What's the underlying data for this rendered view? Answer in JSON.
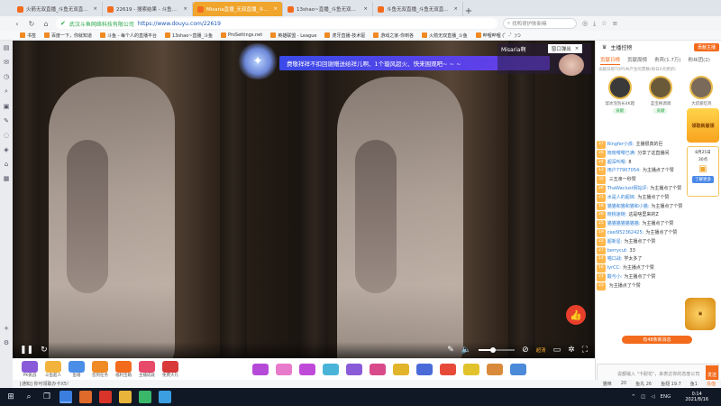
{
  "tabs": [
    {
      "title": "火箭无双直播_斗鱼无双直播视频"
    },
    {
      "title": "22619 - 搜索结果 - 斗鱼直播"
    },
    {
      "title": "Misaria直播_无双直播_斗鱼直播",
      "active": true
    },
    {
      "title": "13shao~直播_斗鱼无双直播视频"
    },
    {
      "title": "斗鱼无双直播_斗鱼无双直播视频"
    }
  ],
  "address": {
    "site_name": "武汉斗鱼网络科技有限公司",
    "url": "https://www.douyu.com/22619",
    "search_placeholder": "找鸭哥护肤新嘛"
  },
  "bookmarks": [
    "书签",
    "百度一下，你就知道",
    "斗鱼 - 每个人的直播平台",
    "13shao~直播_斗鱼",
    "ProSettings.net",
    "英雄联盟 - League",
    "虎牙直播-技术驱",
    "游戏之家-你到各",
    "火箭无双直播_斗鱼",
    "哔哩哔哩 (゜-゜)つ"
  ],
  "video": {
    "streamer_name": "Misaria啊",
    "popout_label": "窗口弹出",
    "banner_text": "费敬祥祥不扣回谢赠送给祥儿啊、1个璇风超火、快来围观吧~ ~ ~",
    "quality_label": "超清",
    "volume": 0.4
  },
  "gifts": [
    {
      "label": "PK挑战",
      "color": "#8a5bd8"
    },
    {
      "label": "斗鱼超人",
      "color": "#f2b33d"
    },
    {
      "label": "鱼塘",
      "color": "#4b8ee8"
    },
    {
      "label": "签到任务",
      "color": "#f08a24"
    },
    {
      "label": "福利宝箱",
      "color": "#f36b1c"
    },
    {
      "label": "主播成就",
      "color": "#e84a6a"
    },
    {
      "label": "免费大礼",
      "color": "#d83a3a"
    },
    {
      "label": "",
      "color": "#b54ad8"
    },
    {
      "label": "",
      "color": "#e87acb"
    },
    {
      "label": "",
      "color": "#c04ad8"
    },
    {
      "label": "",
      "color": "#4ab4d8"
    },
    {
      "label": "",
      "color": "#8a5bd8"
    },
    {
      "label": "",
      "color": "#d84a8a"
    },
    {
      "label": "",
      "color": "#e2b42a"
    },
    {
      "label": "",
      "color": "#4a6ad8"
    },
    {
      "label": "",
      "color": "#e84a3a"
    },
    {
      "label": "",
      "color": "#e2c22a"
    },
    {
      "label": "",
      "color": "#d88a3a"
    },
    {
      "label": "",
      "color": "#4a8ad8"
    }
  ],
  "chat_panel": {
    "title": "主播控榜",
    "add_label": "贡献主播",
    "rank_tabs": [
      "贡献日榜",
      "贡献周榜",
      "贵宾(1.7万)",
      "粉丝团(2)"
    ],
    "rank_desc": "贡献日榜TOP5共产生的票数(每日0点更新)",
    "podium": [
      {
        "name": "溜冰泡泡长4K蹬",
        "tag": "贡献"
      },
      {
        "name": "蓝宝格调调",
        "tag": "贡献"
      },
      {
        "name": "大叔爱吃鸡",
        "tag": "贡献"
      }
    ],
    "messages": [
      {
        "lv": "27",
        "user": "Ringfer小孩:",
        "text": "主播很真的巨"
      },
      {
        "lv": "26",
        "user": "晓晓嘤嘤已满:",
        "text": "分享了这直播间"
      },
      {
        "lv": "24",
        "user": "超深叫嗯:",
        "text": "8"
      },
      {
        "lv": "12",
        "user": "用户77907054:",
        "text": "为主播点了个赞"
      },
      {
        "lv": "32",
        "user": "",
        "text": "三五亲一秒赞"
      },
      {
        "lv": "26",
        "user": "ThaWaclust网站评:",
        "text": "为主播点了个赞"
      },
      {
        "lv": "21",
        "user": "水是人的超妹:",
        "text": "为主播点了个赞"
      },
      {
        "lv": "18",
        "user": "猫猫和猫和猫和小猫:",
        "text": "为主播点了个赞"
      },
      {
        "lv": "20",
        "user": "晓桃速链:",
        "text": "这是啥里来的Z"
      },
      {
        "lv": "25",
        "user": "猫猫猫猫猫猫猫:",
        "text": "为主播点了个赞"
      },
      {
        "lv": "19",
        "user": "ceel952362425:",
        "text": "为主播点了个赞"
      },
      {
        "lv": "22",
        "user": "超新星:",
        "text": "为主播点了个赞"
      },
      {
        "lv": "27",
        "user": "berrycut:",
        "text": "33"
      },
      {
        "lv": "14",
        "user": "喵口战:",
        "text": "学太多了"
      },
      {
        "lv": "16",
        "user": "lyrCC:",
        "text": "为主播点了个赞"
      },
      {
        "lv": "21",
        "user": "酸与小:",
        "text": "为主播点了个赞"
      },
      {
        "lv": "23",
        "user": "",
        "text": "为主播点了个赞"
      }
    ],
    "new_message_label": "有48条新消息",
    "input_placeholder": "说都输入 \"卡耐花\"，来表达你的态度公司",
    "send_label": "发送",
    "ad": {
      "top": "领取新版领",
      "date": "8月25日",
      "count": "30点",
      "button": "了解更多"
    }
  },
  "statusbar": {
    "left": "[通知] 你可领取办卡X5!",
    "items": [
      "猫咪",
      "20",
      "鱼丸 26",
      "鱼翅 19.7",
      "鱼1",
      "充值"
    ]
  },
  "taskbar": {
    "lang": "ENG",
    "time": "0:14",
    "date": "2021/8/16"
  }
}
